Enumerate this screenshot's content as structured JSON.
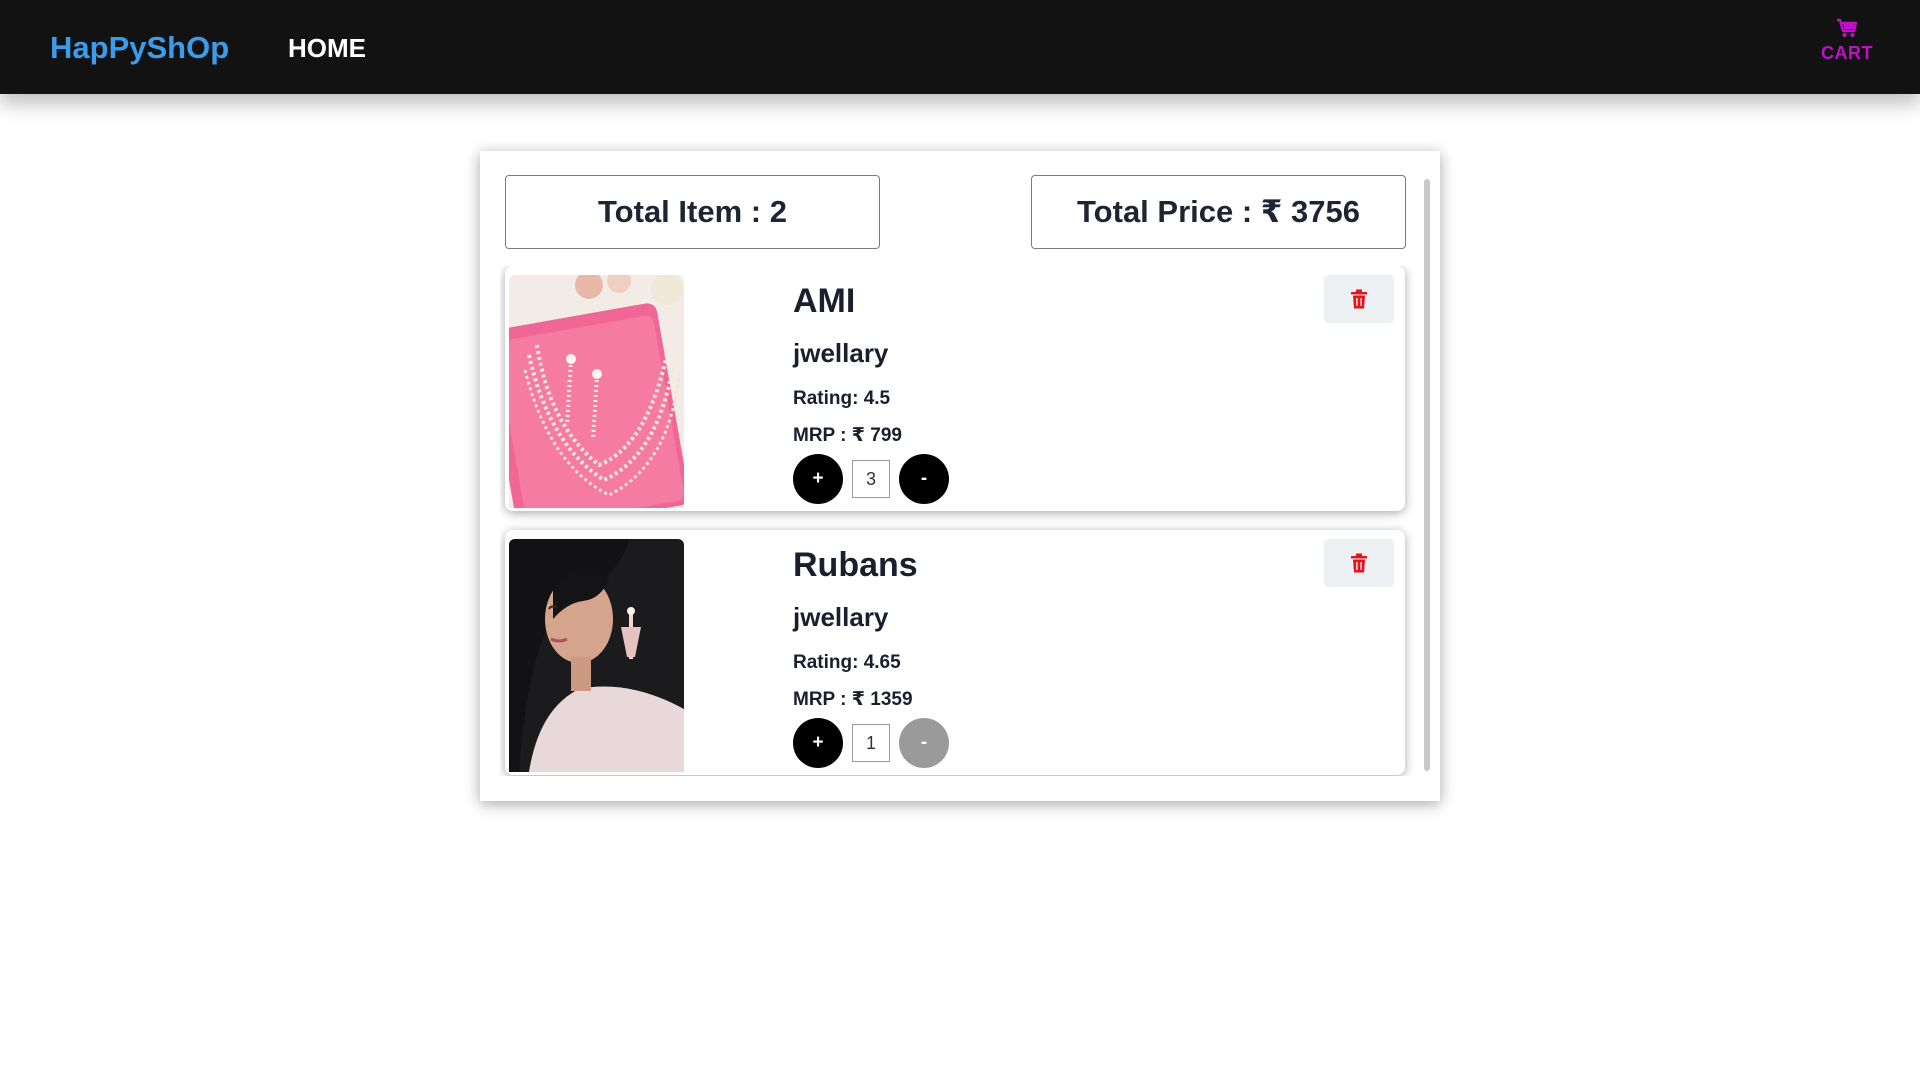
{
  "navbar": {
    "brand": "HapPyShOp",
    "home_label": "HOME",
    "cart_label": "CART",
    "cart_icon": "cart-icon",
    "brand_color": "#3b9dea",
    "cart_color": "#c010c8"
  },
  "summary": {
    "total_items": "Total Item : 2",
    "total_price": "Total Price : ₹ 3756"
  },
  "products": [
    {
      "title": "AMI",
      "category": "jwellary",
      "rating": "Rating: 4.5",
      "mrp": "MRP : ₹ 799",
      "quantity": "3",
      "plus_label": "+",
      "minus_label": "-",
      "minus_disabled": false,
      "image": "necklace-earring-set-on-pink-tray"
    },
    {
      "title": "Rubans",
      "category": "jwellary",
      "rating": "Rating: 4.65",
      "mrp": "MRP : ₹ 1359",
      "quantity": "1",
      "plus_label": "+",
      "minus_label": "-",
      "minus_disabled": true,
      "image": "woman-wearing-drop-earrings"
    }
  ],
  "delete_icon": "trash-icon",
  "delete_color": "#e8101a"
}
